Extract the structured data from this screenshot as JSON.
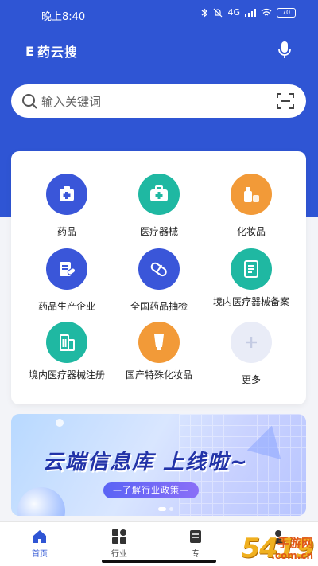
{
  "status_bar": {
    "time": "晚上8:40",
    "signal": "4G",
    "battery": "70"
  },
  "app": {
    "title": "药云搜",
    "logo_letter": "E"
  },
  "search": {
    "placeholder": "输入关键词"
  },
  "categories": [
    {
      "label": "药品",
      "icon": "medicine-box-icon",
      "color": "#3a56d9"
    },
    {
      "label": "医疗器械",
      "icon": "medical-kit-icon",
      "color": "#1fb8a2"
    },
    {
      "label": "化妆品",
      "icon": "cosmetics-icon",
      "color": "#f29a38"
    },
    {
      "label": "药品生产企业",
      "icon": "pharma-enterprise-icon",
      "color": "#3a56d9"
    },
    {
      "label": "全国药品抽检",
      "icon": "pill-capsule-icon",
      "color": "#3a56d9"
    },
    {
      "label": "境内医疗器械备案",
      "icon": "device-record-icon",
      "color": "#1fb8a2"
    },
    {
      "label": "境内医疗器械注册",
      "icon": "building-icon",
      "color": "#1fb8a2"
    },
    {
      "label": "国产特殊化妆品",
      "icon": "tube-icon",
      "color": "#f29a38"
    },
    {
      "label": "更多",
      "icon": "plus-icon",
      "color": "#e9ecf7"
    }
  ],
  "banner": {
    "headline": "云端信息库 上线啦~",
    "cta": "—了解行业政策—"
  },
  "tabs": [
    {
      "label": "首页",
      "icon": "home-icon",
      "active": true
    },
    {
      "label": "行业",
      "icon": "grid-icon",
      "active": false
    },
    {
      "label": "专",
      "icon": "topic-icon",
      "active": false
    },
    {
      "label": "",
      "icon": "user-icon",
      "active": false
    }
  ],
  "watermark": {
    "brand": "5419",
    "site": "手游网",
    "url": ".com.cn"
  },
  "colors": {
    "primary": "#2f55d4",
    "teal": "#1fb8a2",
    "orange": "#f29a38"
  }
}
